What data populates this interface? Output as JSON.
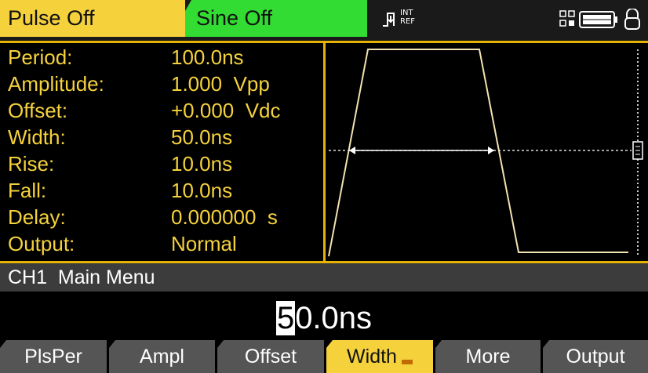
{
  "header": {
    "channel1_tab": "Pulse Off",
    "channel2_tab": "Sine Off",
    "clock_ref": [
      "INT",
      "REF"
    ]
  },
  "params": [
    {
      "label": "Period:",
      "value": "100.0ns"
    },
    {
      "label": "Amplitude:",
      "value": "1.000  Vpp"
    },
    {
      "label": "Offset:",
      "value": "+0.000  Vdc"
    },
    {
      "label": "Width:",
      "value": "50.0ns"
    },
    {
      "label": "Rise:",
      "value": "10.0ns"
    },
    {
      "label": "Fall:",
      "value": "10.0ns"
    },
    {
      "label": "Delay:",
      "value": "0.000000  s"
    },
    {
      "label": "Output:",
      "value": "Normal"
    }
  ],
  "menu_bar": {
    "title": "CH1  Main Menu"
  },
  "entry": {
    "cursor_digit": "5",
    "rest": "0.0ns"
  },
  "softkeys": [
    "PlsPer",
    "Ampl",
    "Offset",
    "Width",
    "More",
    "Output"
  ],
  "active_softkey": "Width",
  "colors": {
    "ch1": "#f5d23c",
    "ch2": "#32dc32",
    "frame": "#e6b400",
    "menu": "#3c3c3c",
    "softkey": "#555555"
  },
  "icons": [
    "pulse-clock-icon",
    "usb-icon",
    "battery-icon",
    "lock-icon",
    "scroll-indicator-icon"
  ]
}
